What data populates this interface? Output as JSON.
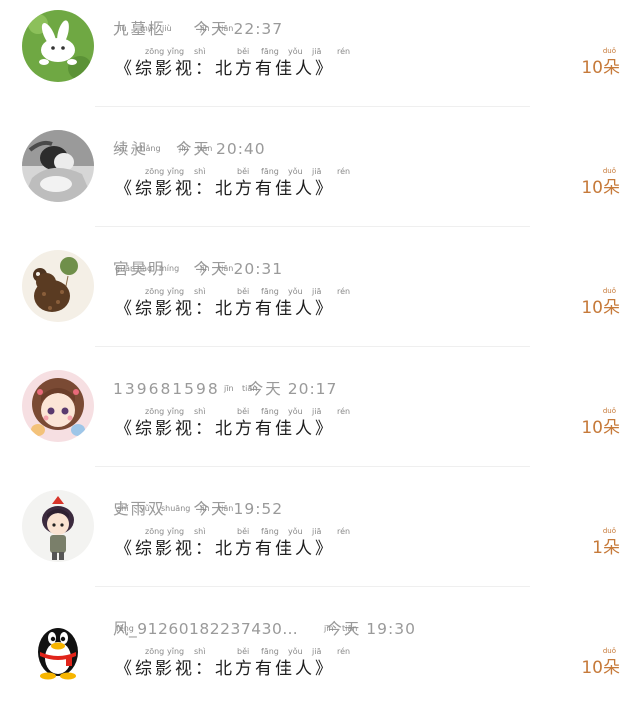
{
  "gifts": [
    {
      "name": "九墓柩",
      "name_pinyin": [
        "jiǔ",
        "mù",
        "jiù"
      ],
      "today": "今天",
      "today_pinyin": [
        "jīn",
        "tiān"
      ],
      "time": "22:37",
      "message": "《综影视：北方有佳人》",
      "count": "10朵",
      "avatar": "green-rabbit-avatar"
    },
    {
      "name": "续昶",
      "name_pinyin": [
        "xù",
        "chǎng"
      ],
      "today": "今天",
      "today_pinyin": [
        "jīn",
        "tiān"
      ],
      "time": "20:40",
      "message": "《综影视：北方有佳人》",
      "count": "10朵",
      "avatar": "bw-photo-avatar"
    },
    {
      "name": "官昊明",
      "name_pinyin": [
        "guān",
        "hào",
        "míng"
      ],
      "today": "今天",
      "today_pinyin": [
        "jīn",
        "tiān"
      ],
      "time": "20:31",
      "message": "《综影视：北方有佳人》",
      "count": "10朵",
      "avatar": "bear-balloon-avatar"
    },
    {
      "name": "139681598",
      "name_pinyin": [],
      "today": "今天",
      "today_pinyin": [
        "jīn",
        "tiān"
      ],
      "time": "20:17",
      "message": "《综影视：北方有佳人》",
      "count": "10朵",
      "avatar": "anime-girl-avatar"
    },
    {
      "name": "史雨双",
      "name_pinyin": [
        "shǐ",
        "yǔ",
        "shuāng"
      ],
      "today": "今天",
      "today_pinyin": [
        "jīn",
        "tiān"
      ],
      "time": "19:52",
      "message": "《综影视：北方有佳人》",
      "count": "1朵",
      "avatar": "chibi-girl-avatar"
    },
    {
      "name": "风_91260182237430…",
      "name_pinyin": [
        "fēng"
      ],
      "today": "今天",
      "today_pinyin": [
        "jīn",
        "tiān"
      ],
      "time": "19:30",
      "message": "《综影视：北方有佳人》",
      "count": "10朵",
      "avatar": "qq-penguin-avatar"
    }
  ],
  "message_pinyin": [
    "zōng",
    "yǐng",
    "shì",
    "běi",
    "fāng",
    "yǒu",
    "jiā",
    "rén"
  ],
  "gift_pinyin": "duǒ",
  "colors": {
    "meta": "#9a9a9a",
    "message": "#1e1e1e",
    "count": "#c67a3a",
    "divider": "#efefef"
  }
}
